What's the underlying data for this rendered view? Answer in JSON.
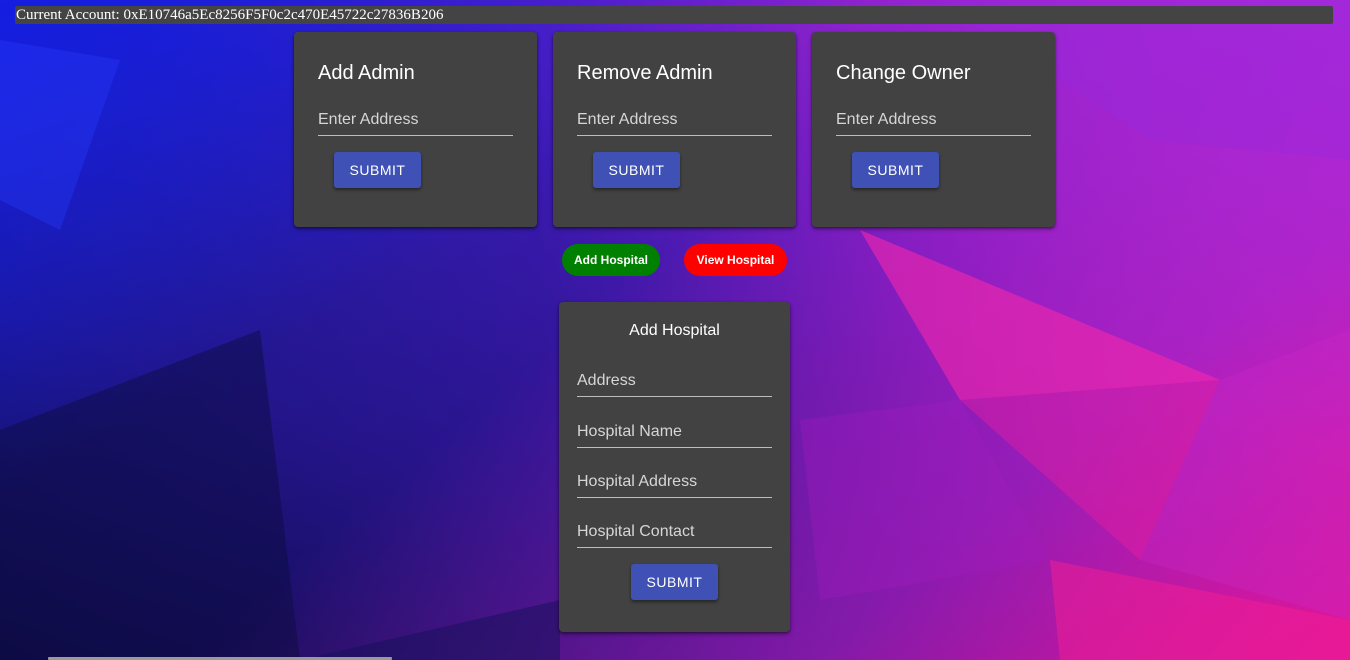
{
  "account": {
    "label": "Current Account: 0xE10746a5Ec8256F5F0c2c470E45722c27836B206"
  },
  "admin_cards": [
    {
      "title": "Add Admin",
      "placeholder": "Enter Address",
      "submit_label": "SUBMIT"
    },
    {
      "title": "Remove Admin",
      "placeholder": "Enter Address",
      "submit_label": "SUBMIT"
    },
    {
      "title": "Change Owner",
      "placeholder": "Enter Address",
      "submit_label": "SUBMIT"
    }
  ],
  "toggles": {
    "add_hospital_label": "Add Hospital",
    "view_hospital_label": "View Hospital"
  },
  "hospital_form": {
    "title": "Add Hospital",
    "fields": [
      {
        "placeholder": "Address"
      },
      {
        "placeholder": "Hospital Name"
      },
      {
        "placeholder": "Hospital Address"
      },
      {
        "placeholder": "Hospital Contact"
      }
    ],
    "submit_label": "SUBMIT"
  },
  "stray_text": "..",
  "colors": {
    "card_bg": "#424242",
    "button_primary": "#3f51b5",
    "pill_green": "#008000",
    "pill_red": "#ff0000"
  }
}
